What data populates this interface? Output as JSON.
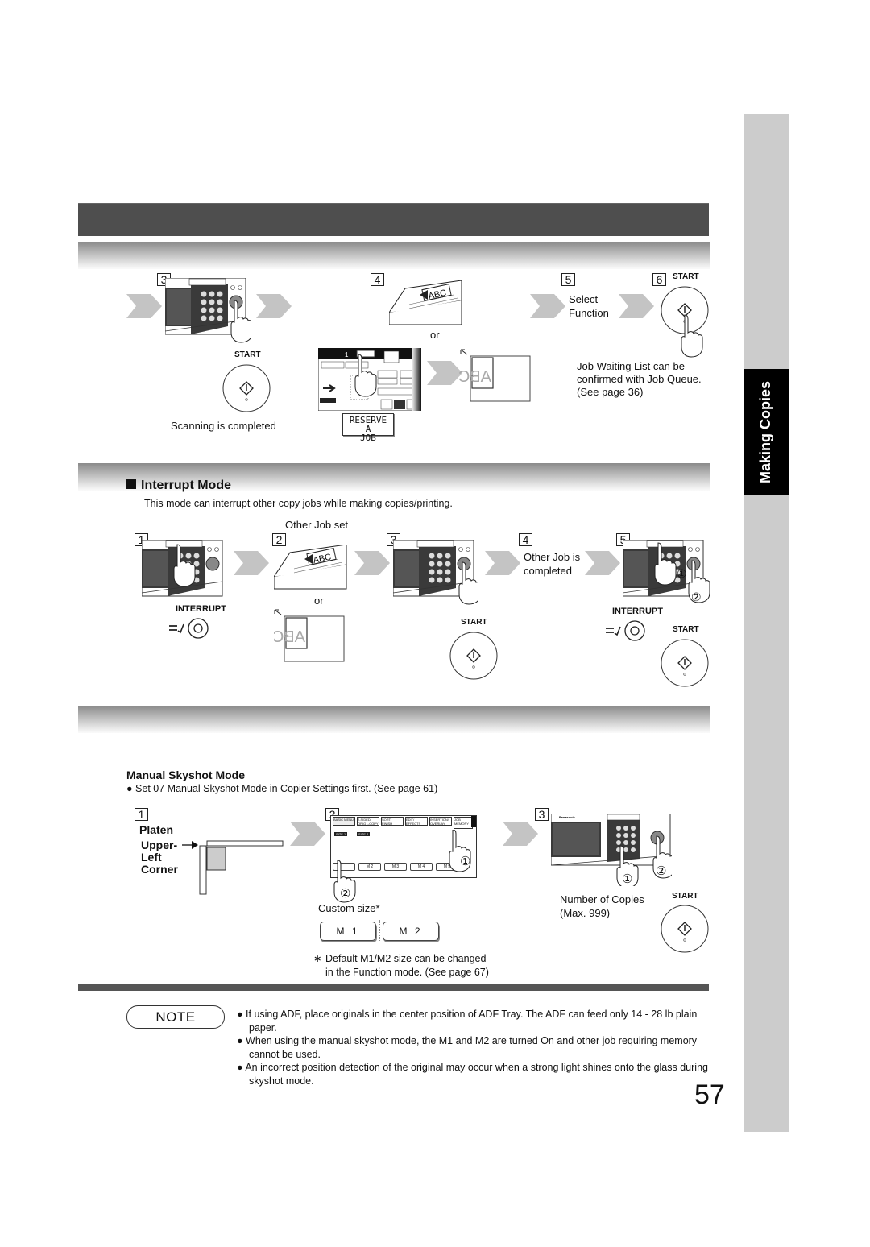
{
  "side_tab": {
    "label": "Making Copies"
  },
  "section_top": {
    "steps": [
      {
        "num": "3",
        "caption": "Scanning is completed",
        "start_label": "START"
      },
      {
        "num": "4",
        "or_label": "or",
        "reserve_button": "RESERVE A JOB"
      },
      {
        "num": "5",
        "caption_line1": "Select",
        "caption_line2": "Function"
      },
      {
        "num": "6",
        "start_label": "START"
      }
    ],
    "job_queue_note": [
      "Job Waiting List can be",
      "confirmed with Job Queue.",
      "(See page 36)"
    ]
  },
  "interrupt": {
    "title": "Interrupt Mode",
    "description": "This mode can interrupt other copy jobs while making copies/printing.",
    "steps": [
      {
        "num": "1",
        "button_label": "INTERRUPT"
      },
      {
        "num": "2",
        "caption": "Other Job set",
        "or_label": "or"
      },
      {
        "num": "3",
        "start_label": "START"
      },
      {
        "num": "4",
        "caption_line1": "Other Job is",
        "caption_line2": "completed"
      },
      {
        "num": "5",
        "button_label": "INTERRUPT",
        "start_label": "START",
        "marker1": "①",
        "marker2": "②"
      }
    ]
  },
  "skyshot": {
    "title": "Manual Skyshot Mode",
    "bullet": "Set 07 Manual Skyshot Mode in Copier Settings first. (See page 61)",
    "steps": [
      {
        "num": "1",
        "label1": "Platen",
        "label2": "Upper-",
        "label3": "Left",
        "label4": "Corner"
      },
      {
        "num": "2",
        "marker1": "①",
        "marker2": "②",
        "custom_size": "Custom size*",
        "btn_m1": "M 1",
        "btn_m2": "M 2",
        "screen_tabs": [
          "BASIC MENU",
          "2-SIDED/ ORIG→COPY",
          "SORT/ FINISH",
          "EDIT/ EFFECTS",
          "INSERTION/ OVERLAY",
          "JOB MEMORY"
        ],
        "screen_slots": [
          "M 1",
          "M 2",
          "M 3",
          "M 4",
          "M 5"
        ],
        "screen_size_labels": [
          "SIZE 1",
          "SIZE 2"
        ],
        "footnote_line1": "Default M1/M2 size can be changed",
        "footnote_line2": "in the Function mode. (See page 67)",
        "footnote_mark": "∗"
      },
      {
        "num": "3",
        "caption_line1": "Number of Copies",
        "caption_line2": "(Max. 999)",
        "start_label": "START",
        "marker1": "①",
        "marker2": "②"
      }
    ]
  },
  "note": {
    "label": "NOTE",
    "items": [
      "If using ADF, place originals in the center position of ADF Tray. The ADF can feed only 14 - 28 lb plain paper.",
      "When using the manual skyshot mode, the M1 and M2 are turned On and other job requiring memory cannot be used.",
      "An incorrect position detection of the original may occur when a strong light shines onto the glass during skyshot mode."
    ]
  },
  "page_number": "57",
  "colors": {
    "dark_bar": "#4e4e4e",
    "side_tab": "#cccccc",
    "arrow": "#c4c4c4"
  }
}
